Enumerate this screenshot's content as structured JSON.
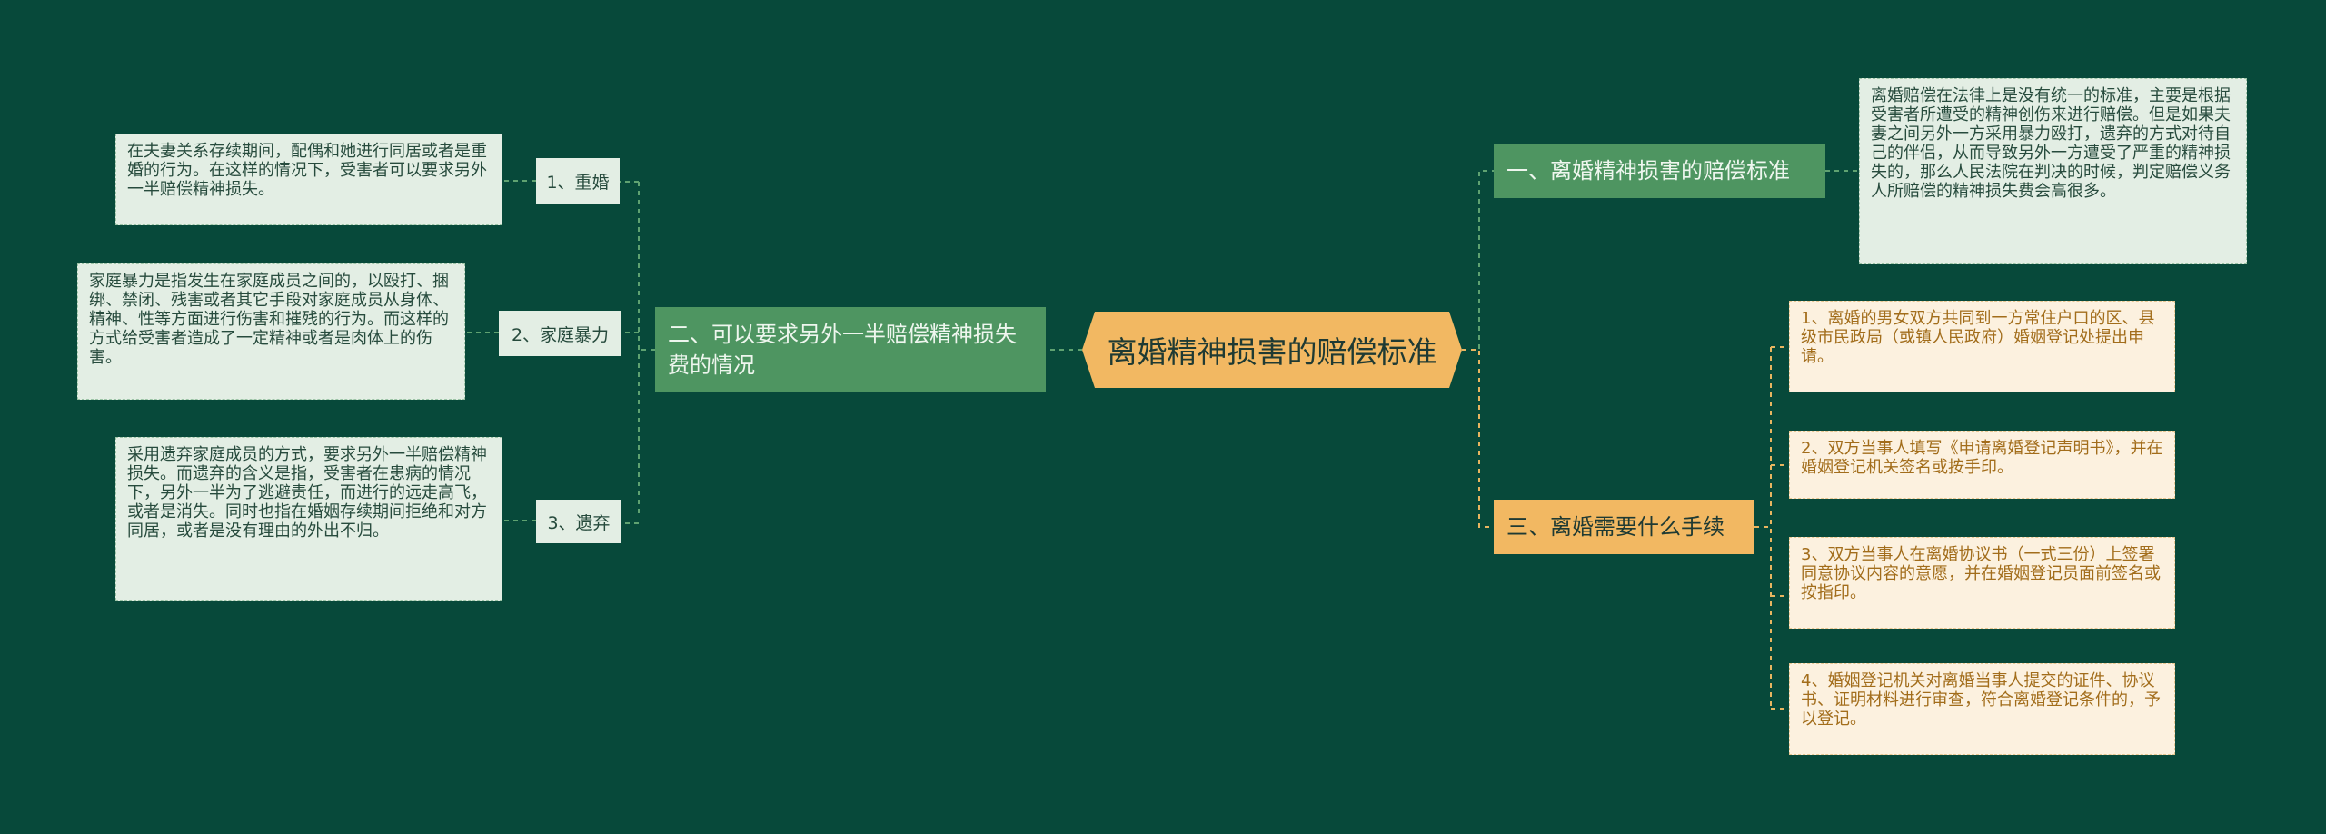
{
  "center": {
    "title": "离婚精神损害的赔偿标准"
  },
  "branch1": {
    "title": "一、离婚精神损害的赔偿标准",
    "detail": "离婚赔偿在法律上是没有统一的标准，主要是根据受害者所遭受的精神创伤来进行赔偿。但是如果夫妻之间另外一方采用暴力殴打，遗弃的方式对待自己的伴侣，从而导致另外一方遭受了严重的精神损失的，那么人民法院在判决的时候，判定赔偿义务人所赔偿的精神损失费会高很多。"
  },
  "branch2": {
    "title": "二、可以要求另外一半赔偿精神损失费的情况",
    "items": [
      {
        "label": "1、重婚",
        "text": "在夫妻关系存续期间，配偶和她进行同居或者是重婚的行为。在这样的情况下，受害者可以要求另外一半赔偿精神损失。"
      },
      {
        "label": "2、家庭暴力",
        "text": "家庭暴力是指发生在家庭成员之间的，以殴打、捆绑、禁闭、残害或者其它手段对家庭成员从身体、精神、性等方面进行伤害和摧残的行为。而这样的方式给受害者造成了一定精神或者是肉体上的伤害。"
      },
      {
        "label": "3、遗弃",
        "text": "采用遗弃家庭成员的方式，要求另外一半赔偿精神损失。而遗弃的含义是指，受害者在患病的情况下，另外一半为了逃避责任，而进行的远走高飞，或者是消失。同时也指在婚姻存续期间拒绝和对方同居，或者是没有理由的外出不归。"
      }
    ]
  },
  "branch3": {
    "title": "三、离婚需要什么手续",
    "items": [
      {
        "text": "1、离婚的男女双方共同到一方常住户口的区、县级市民政局（或镇人民政府）婚姻登记处提出申请。"
      },
      {
        "text": "2、双方当事人填写《申请离婚登记声明书》，并在婚姻登记机关签名或按手印。"
      },
      {
        "text": "3、双方当事人在离婚协议书（一式三份）上签署同意协议内容的意愿，并在婚姻登记员面前签名或按指印。"
      },
      {
        "text": "4、婚姻登记机关对离婚当事人提交的证件、协议书、证明材料进行审查，符合离婚登记条件的，予以登记。"
      }
    ]
  },
  "colors": {
    "background": "#07493a",
    "center": "#f2b862",
    "green_branch": "#4e9561",
    "green_leaf": "#e3eee4",
    "orange_leaf": "#fcf1df"
  }
}
